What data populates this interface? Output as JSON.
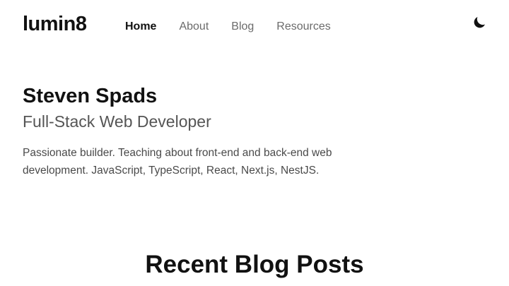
{
  "header": {
    "logo": "lumin8",
    "nav": [
      {
        "label": "Home",
        "active": true
      },
      {
        "label": "About",
        "active": false
      },
      {
        "label": "Blog",
        "active": false
      },
      {
        "label": "Resources",
        "active": false
      }
    ],
    "theme_toggle_icon": "moon-icon"
  },
  "hero": {
    "name": "Steven Spads",
    "role": "Full-Stack Web Developer",
    "bio": "Passionate builder. Teaching about front-end and back-end web development. JavaScript, TypeScript, React, Next.js, NestJS."
  },
  "recent_posts": {
    "title": "Recent Blog Posts"
  },
  "colors": {
    "text": "#111111",
    "muted_nav": "#6b6b6b",
    "subtitle": "#555555",
    "background": "#ffffff"
  }
}
